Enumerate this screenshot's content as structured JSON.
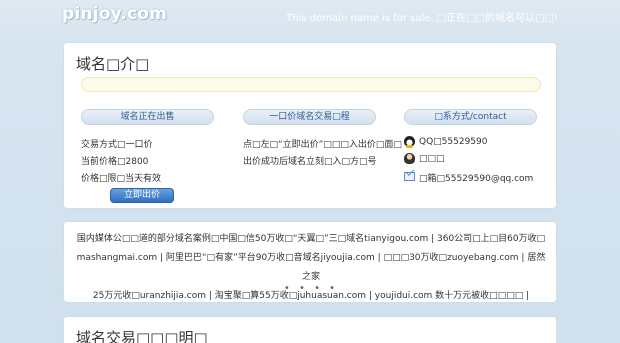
{
  "header": {
    "logo": "pinjoy.com",
    "sale_note": "This domain name is for sale. □正在□□的域名可以□□!"
  },
  "intro": {
    "title": "域名□介□"
  },
  "columns": {
    "col1": {
      "head": "域名正在出售",
      "lines": [
        "交易方式□一口价",
        "当前价格□2800",
        "价格□限□当天有效"
      ],
      "button": "立即出价"
    },
    "col2": {
      "head": "一口价域名交易□程",
      "lines": [
        "点□左□“立即出价”□□□入出价□面□",
        "出价成功后域名立刻□入□方□号"
      ]
    },
    "col3": {
      "head": "□系方式/contact",
      "qq": "QQ□55529590",
      "name": "□□□",
      "email": "□箱□55529590@qq.com"
    }
  },
  "icons": {
    "qq": "qq-penguin-icon",
    "user": "user-icon",
    "mail": "mail-icon"
  },
  "cases": {
    "line1": "国内媒体公□□道的部分域名案例□中国□信50万收□“天翼□”三□域名tianyigou.com | 360公司□上□目60万收□",
    "line2": "mashangmai.com | 阿里巴巴“□有家”平台90万收□音域名jiyoujia.com | □□□30万收□zuoyebang.com | 居然之家",
    "line3": "25万元收□uranzhijia.com | 淘宝聚□算55万收□juhuasuan.com | youjidui.com 数十万元被收□□□□ |",
    "dots": "• • • •"
  },
  "bottom": {
    "title": "域名交易□□□明□"
  }
}
